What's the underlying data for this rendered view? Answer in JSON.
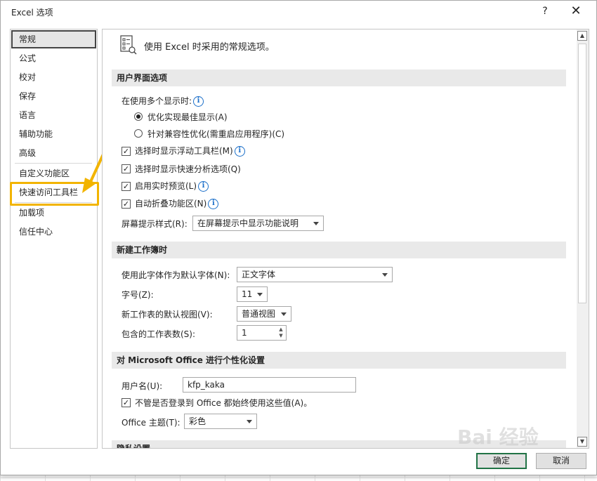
{
  "window": {
    "title": "Excel 选项",
    "help": "?",
    "close": "✕"
  },
  "nav": {
    "items": [
      "常规",
      "公式",
      "校对",
      "保存",
      "语言",
      "辅助功能",
      "高级",
      "自定义功能区",
      "快速访问工具栏",
      "加载项",
      "信任中心"
    ],
    "selected": "常规",
    "highlighted": "快速访问工具栏"
  },
  "content": {
    "header": "使用 Excel 时采用的常规选项。",
    "sections": {
      "ui": "用户界面选项",
      "newbook": "新建工作簿时",
      "personal": "对 Microsoft Office 进行个性化设置",
      "privacy": "隐私设置"
    },
    "ui": {
      "multi_display": "在使用多个显示时:",
      "radio_optimize": "优化实现最佳显示(A)",
      "radio_compat": "针对兼容性优化(需重启应用程序)(C)",
      "check_minitoolbar": "选择时显示浮动工具栏(M)",
      "check_quickanalysis": "选择时显示快速分析选项(Q)",
      "check_livepreview": "启用实时预览(L)",
      "check_collapse": "自动折叠功能区(N)",
      "tooltip_label": "屏幕提示样式(R):",
      "tooltip_value": "在屏幕提示中显示功能说明"
    },
    "newbook": {
      "font_label": "使用此字体作为默认字体(N):",
      "font_value": "正文字体",
      "size_label": "字号(Z):",
      "size_value": "11",
      "view_label": "新工作表的默认视图(V):",
      "view_value": "普通视图",
      "sheets_label": "包含的工作表数(S):",
      "sheets_value": "1"
    },
    "personal": {
      "user_label": "用户名(U):",
      "user_value": "kfp_kaka",
      "always_use": "不管是否登录到 Office 都始终使用这些值(A)。",
      "theme_label": "Office 主题(T):",
      "theme_value": "彩色"
    }
  },
  "buttons": {
    "ok": "确定",
    "cancel": "取消"
  },
  "colors": {
    "highlight": "#f2b400",
    "info": "#1b6fc9",
    "primary_border": "#217346"
  },
  "watermark": "Bai 经验"
}
